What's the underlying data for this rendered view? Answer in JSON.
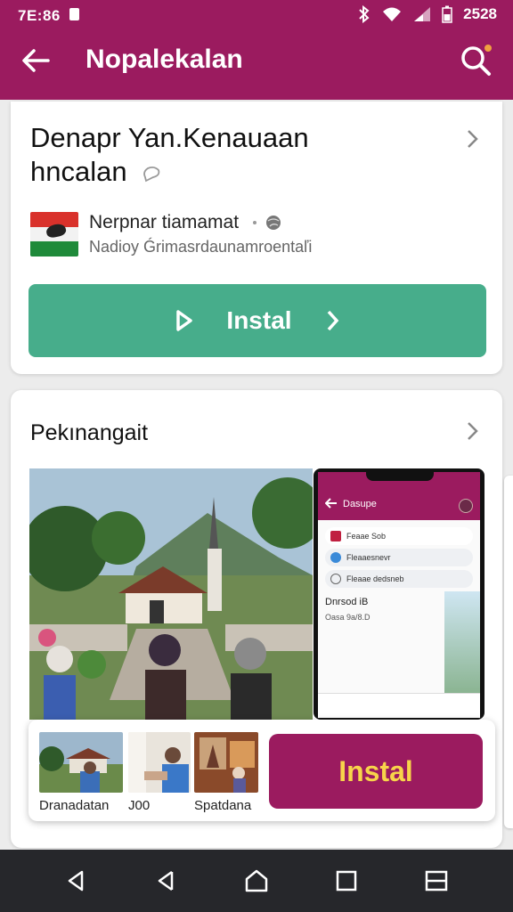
{
  "status_bar": {
    "time": "7E:86",
    "clock_right": "2528"
  },
  "app_bar": {
    "title": "Nopalekalan",
    "back_icon": "arrow-left-icon",
    "search_icon": "search-icon",
    "search_badge_color": "#f0a040"
  },
  "app_card": {
    "title_line1": "Denapr Yan.Kenauaan",
    "title_line2": "hncalan",
    "publisher_name": "Nerpnar tiamamat",
    "publisher_subtitle": "Nadioy Ǵrimasrdaunamroentaľi",
    "install_label": "Instal",
    "install_color": "#47ad8b"
  },
  "recommend_card": {
    "title": "Pekınangait",
    "phone": {
      "title": "Dasupe",
      "row1": "Feaae Sob",
      "row2": "Fleaaesnevr",
      "row3": "Fleaae dedsneb",
      "label": "Dnrsod iB",
      "sub": "Oasa 9a/8.D"
    },
    "thumbnails": [
      {
        "label": "Dranadatan"
      },
      {
        "label": "J00"
      },
      {
        "label": "Spatdana"
      }
    ],
    "install_label": "Instal",
    "install_color": "#9b1b5f",
    "install_text_color": "#f7d44a"
  },
  "nav_bar": {
    "icons": [
      "nav-back-outline-icon",
      "nav-back-icon",
      "nav-home-icon",
      "nav-recents-icon",
      "nav-menu-icon"
    ]
  },
  "colors": {
    "brand": "#9b1b5f",
    "nav_bg": "#26272b"
  }
}
